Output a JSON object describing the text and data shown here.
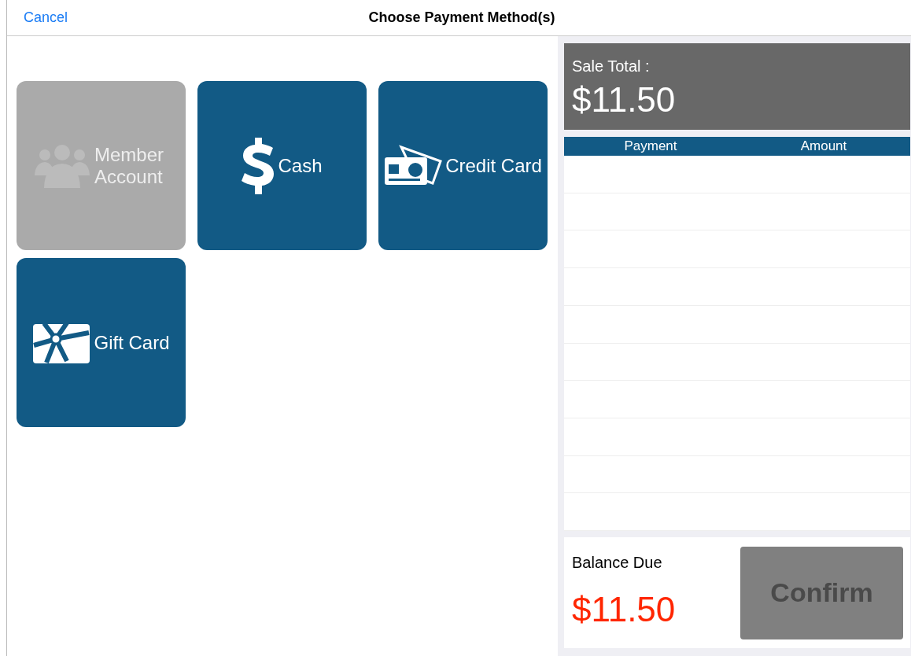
{
  "header": {
    "cancel": "Cancel",
    "title": "Choose Payment Method(s)"
  },
  "methods": [
    {
      "kind": "member",
      "label": "Member Account",
      "disabled": true
    },
    {
      "kind": "cash",
      "label": "Cash",
      "disabled": false
    },
    {
      "kind": "credit",
      "label": "Credit Card",
      "disabled": false
    },
    {
      "kind": "gift",
      "label": "Gift Card",
      "disabled": false
    }
  ],
  "sale_total": {
    "label": "Sale Total :",
    "amount": "$11.50"
  },
  "payments_table": {
    "columns": [
      "Payment",
      "Amount"
    ]
  },
  "balance": {
    "label": "Balance Due",
    "amount": "$11.50"
  },
  "confirm": {
    "label": "Confirm",
    "disabled": true
  }
}
